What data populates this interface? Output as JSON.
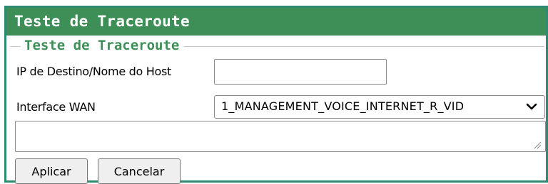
{
  "header": {
    "title": "Teste de Traceroute"
  },
  "form": {
    "legend": "Teste de Traceroute",
    "destination_label": "IP de Destino/Nome do Host",
    "destination_value": "",
    "wan_label": "Interface WAN",
    "wan_selected": "1_MANAGEMENT_VOICE_INTERNET_R_VID",
    "result_text": ""
  },
  "buttons": {
    "apply_label": "Aplicar",
    "cancel_label": "Cancelar"
  },
  "icons": {
    "dropdown": "chevron-down-icon",
    "resize": "resize-grip-icon"
  },
  "colors": {
    "frame_border": "#2f8a73",
    "title_bar": "#3e8e57",
    "legend_text": "#3e8e57"
  }
}
